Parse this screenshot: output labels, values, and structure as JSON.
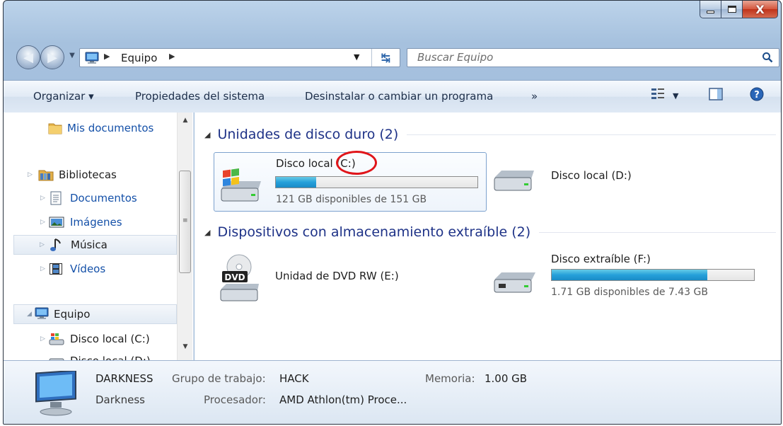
{
  "window": {
    "caption_buttons": {
      "minimize": "minimize-icon",
      "maximize": "maximize-icon",
      "close": "X"
    }
  },
  "address_bar": {
    "segments": [
      "Equipo"
    ],
    "search_placeholder": "Buscar Equipo"
  },
  "toolbar": {
    "organize": "Organizar ▾",
    "system_properties": "Propiedades del sistema",
    "uninstall": "Desinstalar o cambiar un programa",
    "more": "»"
  },
  "nav": {
    "items": [
      {
        "label": "Mis documentos",
        "icon": "folder-icon"
      },
      {
        "label": "Bibliotecas",
        "icon": "libraries-icon"
      },
      {
        "label": "Documentos",
        "icon": "document-icon"
      },
      {
        "label": "Imágenes",
        "icon": "pictures-icon"
      },
      {
        "label": "Música",
        "icon": "music-icon"
      },
      {
        "label": "Vídeos",
        "icon": "video-icon"
      },
      {
        "label": "Equipo",
        "icon": "computer-icon"
      },
      {
        "label": "Disco local (C:)",
        "icon": "windows-drive-icon"
      },
      {
        "label": "Disco local (D:)",
        "icon": "drive-icon"
      }
    ]
  },
  "content": {
    "groups": [
      {
        "title": "Unidades de disco duro (2)"
      },
      {
        "title": "Dispositivos con almacenamiento extraíble (2)"
      }
    ],
    "drives": [
      {
        "name": "Disco local (C:)",
        "free_text": "121 GB disponibles de 151 GB",
        "used_fraction": 0.2,
        "icon": "windows-drive-icon"
      },
      {
        "name": "Disco local (D:)",
        "icon": "drive-icon"
      },
      {
        "name": "Unidad de DVD RW (E:)",
        "icon": "dvd-drive-icon",
        "badge": "DVD"
      },
      {
        "name": "Disco extraíble (F:)",
        "free_text": "1.71 GB disponibles de 7.43 GB",
        "used_fraction": 0.77,
        "icon": "usb-drive-icon"
      }
    ]
  },
  "details": {
    "computer_name": "DARKNESS",
    "description": "Darkness",
    "workgroup_label": "Grupo de trabajo:",
    "workgroup_value": "HACK",
    "memory_label": "Memoria:",
    "memory_value": "1.00 GB",
    "processor_label": "Procesador:",
    "processor_value": "AMD Athlon(tm) Proce..."
  },
  "colors": {
    "accent": "#1e3287",
    "link": "#1450a8",
    "bar_fill": "#26a0da",
    "annotation": "#e0151a"
  }
}
